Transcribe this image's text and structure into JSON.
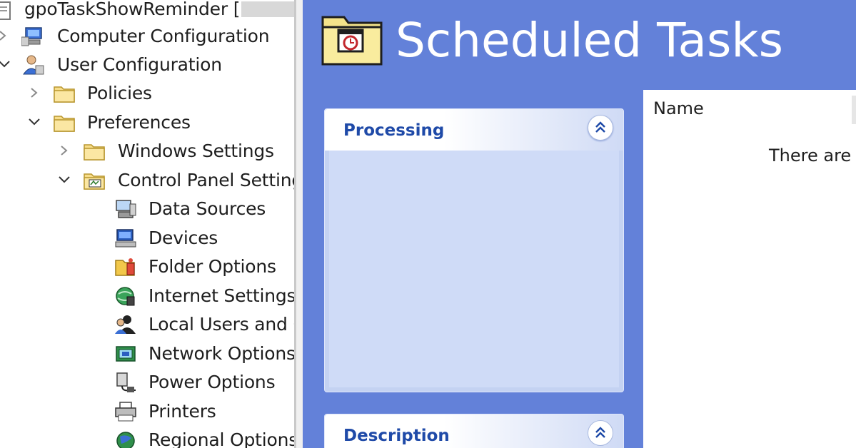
{
  "tree": {
    "root": "gpoTaskShowReminder [",
    "items": [
      {
        "label": "Computer Configuration",
        "icon": "computer-config-icon"
      },
      {
        "label": "User Configuration",
        "icon": "user-config-icon"
      },
      {
        "label": "Policies",
        "icon": "folder-icon"
      },
      {
        "label": "Preferences",
        "icon": "folder-icon"
      },
      {
        "label": "Windows Settings",
        "icon": "folder-icon"
      },
      {
        "label": "Control Panel Setting",
        "icon": "control-panel-icon"
      },
      {
        "label": "Data Sources",
        "icon": "data-sources-icon"
      },
      {
        "label": "Devices",
        "icon": "devices-icon"
      },
      {
        "label": "Folder Options",
        "icon": "folder-options-icon"
      },
      {
        "label": "Internet Settings",
        "icon": "internet-settings-icon"
      },
      {
        "label": "Local Users and G",
        "icon": "local-users-icon"
      },
      {
        "label": "Network Options",
        "icon": "network-options-icon"
      },
      {
        "label": "Power Options",
        "icon": "power-options-icon"
      },
      {
        "label": "Printers",
        "icon": "printers-icon"
      },
      {
        "label": "Regional Options",
        "icon": "regional-options-icon"
      }
    ]
  },
  "panel": {
    "title": "Scheduled Tasks",
    "title_icon": "scheduled-tasks-folder-icon",
    "processing_label": "Processing",
    "description_label": "Description",
    "list_column": "Name",
    "empty_message": "There are n"
  },
  "colors": {
    "panel_bg": "#6381d9",
    "task_body": "#cfdbf7",
    "task_header_text": "#1f4aa8"
  }
}
